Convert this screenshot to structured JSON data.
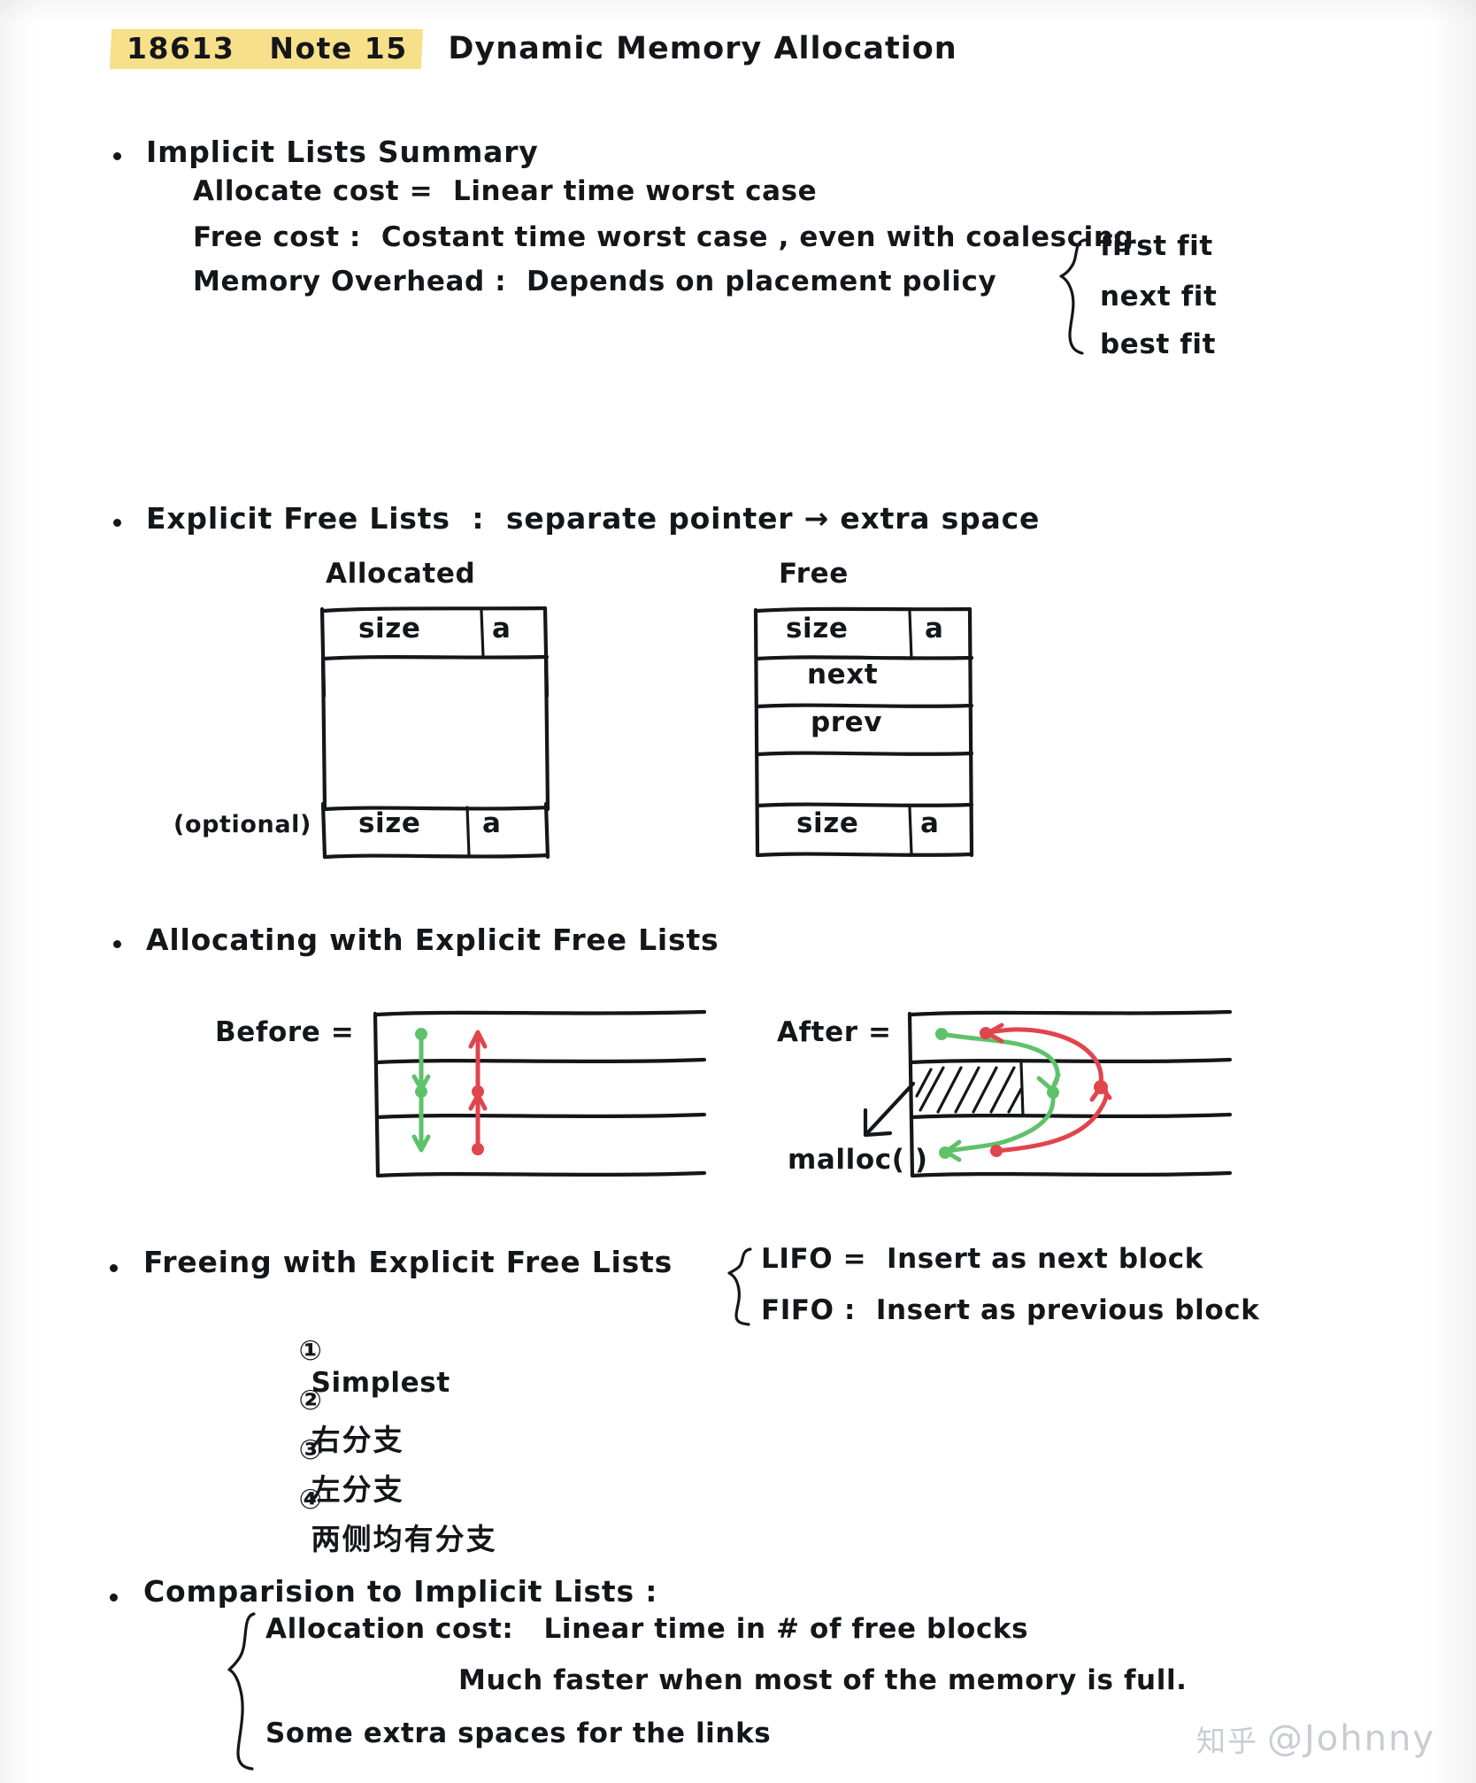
{
  "header": {
    "note_code": "18613   Note 15",
    "title": "Dynamic Memory Allocation",
    "highlight_color": "#f6e08a"
  },
  "sections": [
    {
      "id": "implicit-lists-summary",
      "heading": "Implicit Lists Summary",
      "lines": [
        "Allocate cost =  Linear time worst case",
        "Free cost :  Costant time worst case , even with coalescing",
        "Memory Overhead :  Depends on placement policy"
      ],
      "brace_items": [
        "first fit",
        "next fit",
        "best fit"
      ]
    },
    {
      "id": "explicit-free-lists",
      "heading": "Explicit Free Lists  :  separate pointer → extra space",
      "diagram": {
        "allocated": {
          "label": "Allocated",
          "header_size": "size",
          "header_flag": "a",
          "footer_size": "size",
          "footer_flag": "a",
          "footer_note": "(optional)"
        },
        "free": {
          "label": "Free",
          "header_size": "size",
          "header_flag": "a",
          "rows": [
            "next",
            "prev"
          ],
          "footer_size": "size",
          "footer_flag": "a"
        }
      }
    },
    {
      "id": "allocating-with-explicit-free-lists",
      "heading": "Allocating with Explicit Free Lists",
      "diagram": {
        "before_label": "Before =",
        "after_label": "After =",
        "malloc_label": "malloc( )",
        "next_pointer_color": "#5fc26a",
        "prev_pointer_color": "#e0454d"
      }
    },
    {
      "id": "freeing-with-explicit-free-lists",
      "heading": "Freeing with Explicit Free Lists",
      "policies": [
        "LIFO =  Insert as next block",
        "FIFO :  Insert as previous block"
      ],
      "cases": [
        {
          "num": "①",
          "text": "Simplest"
        },
        {
          "num": "②",
          "text": "右分支"
        },
        {
          "num": "③",
          "text": "左分支"
        },
        {
          "num": "④",
          "text": "两侧均有分支"
        }
      ]
    },
    {
      "id": "comparison-to-implicit-lists",
      "heading": "Comparision to Implicit Lists :",
      "lines": [
        "Allocation cost:   Linear time in # of free blocks",
        "Much faster when most of the memory is full.",
        "Some extra spaces for the links"
      ]
    }
  ],
  "watermark": {
    "site": "知乎",
    "user": "@Johnny"
  }
}
